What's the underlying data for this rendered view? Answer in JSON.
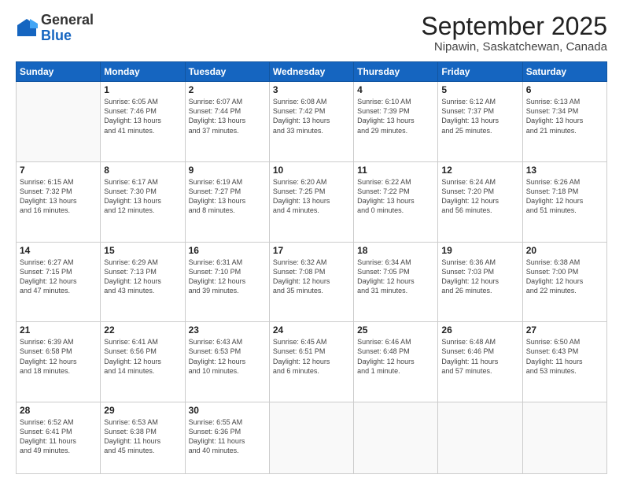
{
  "header": {
    "logo_general": "General",
    "logo_blue": "Blue",
    "month": "September 2025",
    "location": "Nipawin, Saskatchewan, Canada"
  },
  "days_of_week": [
    "Sunday",
    "Monday",
    "Tuesday",
    "Wednesday",
    "Thursday",
    "Friday",
    "Saturday"
  ],
  "weeks": [
    [
      {
        "day": "",
        "info": ""
      },
      {
        "day": "1",
        "info": "Sunrise: 6:05 AM\nSunset: 7:46 PM\nDaylight: 13 hours\nand 41 minutes."
      },
      {
        "day": "2",
        "info": "Sunrise: 6:07 AM\nSunset: 7:44 PM\nDaylight: 13 hours\nand 37 minutes."
      },
      {
        "day": "3",
        "info": "Sunrise: 6:08 AM\nSunset: 7:42 PM\nDaylight: 13 hours\nand 33 minutes."
      },
      {
        "day": "4",
        "info": "Sunrise: 6:10 AM\nSunset: 7:39 PM\nDaylight: 13 hours\nand 29 minutes."
      },
      {
        "day": "5",
        "info": "Sunrise: 6:12 AM\nSunset: 7:37 PM\nDaylight: 13 hours\nand 25 minutes."
      },
      {
        "day": "6",
        "info": "Sunrise: 6:13 AM\nSunset: 7:34 PM\nDaylight: 13 hours\nand 21 minutes."
      }
    ],
    [
      {
        "day": "7",
        "info": "Sunrise: 6:15 AM\nSunset: 7:32 PM\nDaylight: 13 hours\nand 16 minutes."
      },
      {
        "day": "8",
        "info": "Sunrise: 6:17 AM\nSunset: 7:30 PM\nDaylight: 13 hours\nand 12 minutes."
      },
      {
        "day": "9",
        "info": "Sunrise: 6:19 AM\nSunset: 7:27 PM\nDaylight: 13 hours\nand 8 minutes."
      },
      {
        "day": "10",
        "info": "Sunrise: 6:20 AM\nSunset: 7:25 PM\nDaylight: 13 hours\nand 4 minutes."
      },
      {
        "day": "11",
        "info": "Sunrise: 6:22 AM\nSunset: 7:22 PM\nDaylight: 13 hours\nand 0 minutes."
      },
      {
        "day": "12",
        "info": "Sunrise: 6:24 AM\nSunset: 7:20 PM\nDaylight: 12 hours\nand 56 minutes."
      },
      {
        "day": "13",
        "info": "Sunrise: 6:26 AM\nSunset: 7:18 PM\nDaylight: 12 hours\nand 51 minutes."
      }
    ],
    [
      {
        "day": "14",
        "info": "Sunrise: 6:27 AM\nSunset: 7:15 PM\nDaylight: 12 hours\nand 47 minutes."
      },
      {
        "day": "15",
        "info": "Sunrise: 6:29 AM\nSunset: 7:13 PM\nDaylight: 12 hours\nand 43 minutes."
      },
      {
        "day": "16",
        "info": "Sunrise: 6:31 AM\nSunset: 7:10 PM\nDaylight: 12 hours\nand 39 minutes."
      },
      {
        "day": "17",
        "info": "Sunrise: 6:32 AM\nSunset: 7:08 PM\nDaylight: 12 hours\nand 35 minutes."
      },
      {
        "day": "18",
        "info": "Sunrise: 6:34 AM\nSunset: 7:05 PM\nDaylight: 12 hours\nand 31 minutes."
      },
      {
        "day": "19",
        "info": "Sunrise: 6:36 AM\nSunset: 7:03 PM\nDaylight: 12 hours\nand 26 minutes."
      },
      {
        "day": "20",
        "info": "Sunrise: 6:38 AM\nSunset: 7:00 PM\nDaylight: 12 hours\nand 22 minutes."
      }
    ],
    [
      {
        "day": "21",
        "info": "Sunrise: 6:39 AM\nSunset: 6:58 PM\nDaylight: 12 hours\nand 18 minutes."
      },
      {
        "day": "22",
        "info": "Sunrise: 6:41 AM\nSunset: 6:56 PM\nDaylight: 12 hours\nand 14 minutes."
      },
      {
        "day": "23",
        "info": "Sunrise: 6:43 AM\nSunset: 6:53 PM\nDaylight: 12 hours\nand 10 minutes."
      },
      {
        "day": "24",
        "info": "Sunrise: 6:45 AM\nSunset: 6:51 PM\nDaylight: 12 hours\nand 6 minutes."
      },
      {
        "day": "25",
        "info": "Sunrise: 6:46 AM\nSunset: 6:48 PM\nDaylight: 12 hours\nand 1 minute."
      },
      {
        "day": "26",
        "info": "Sunrise: 6:48 AM\nSunset: 6:46 PM\nDaylight: 11 hours\nand 57 minutes."
      },
      {
        "day": "27",
        "info": "Sunrise: 6:50 AM\nSunset: 6:43 PM\nDaylight: 11 hours\nand 53 minutes."
      }
    ],
    [
      {
        "day": "28",
        "info": "Sunrise: 6:52 AM\nSunset: 6:41 PM\nDaylight: 11 hours\nand 49 minutes."
      },
      {
        "day": "29",
        "info": "Sunrise: 6:53 AM\nSunset: 6:38 PM\nDaylight: 11 hours\nand 45 minutes."
      },
      {
        "day": "30",
        "info": "Sunrise: 6:55 AM\nSunset: 6:36 PM\nDaylight: 11 hours\nand 40 minutes."
      },
      {
        "day": "",
        "info": ""
      },
      {
        "day": "",
        "info": ""
      },
      {
        "day": "",
        "info": ""
      },
      {
        "day": "",
        "info": ""
      }
    ]
  ]
}
